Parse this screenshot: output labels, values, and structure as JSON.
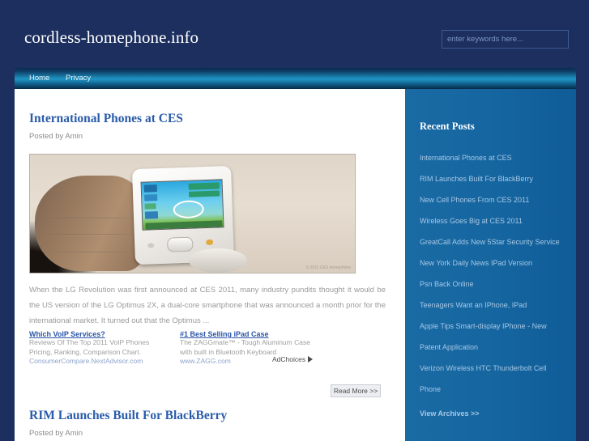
{
  "site": {
    "title": "cordless-homephone.info"
  },
  "search": {
    "placeholder": "enter keywords here...",
    "value": ""
  },
  "nav": {
    "items": [
      {
        "label": "Home"
      },
      {
        "label": "Privacy"
      }
    ]
  },
  "posts": [
    {
      "title": "International Phones at CES",
      "meta": "Posted by Amin",
      "image_watermark": "© 2011 CES homephone",
      "body": "When the LG Revolution was first announced at CES 2011, many industry pundits thought it would be the US version of the LG Optimus 2X, a dual-core smartphone that was announced a month prior for the international market. It turned out that the Optimus ...",
      "read_more": "Read More >>"
    },
    {
      "title": "RIM Launches Built For BlackBerry",
      "meta": "Posted by Amin"
    }
  ],
  "ads": {
    "items": [
      {
        "title": "Which VoIP Services?",
        "line1": "Reviews Of The Top 2011 VoIP Phones",
        "line2": "Pricing, Ranking, Comparison Chart.",
        "url": "ConsumerCompare.NextAdvisor.com"
      },
      {
        "title": "#1 Best Selling iPad Case",
        "line1": "The ZAGGmate™ - Tough Aluminum Case",
        "line2": "with built in Bluetooth Keyboard",
        "url": "www.ZAGG.com"
      }
    ],
    "adchoices_label": "AdChoices"
  },
  "sidebar": {
    "title": "Recent Posts",
    "items": [
      {
        "label": "International Phones at CES"
      },
      {
        "label": "RIM Launches Built For BlackBerry"
      },
      {
        "label": "New Cell Phones From CES 2011"
      },
      {
        "label": "Wireless Goes Big at CES 2011"
      },
      {
        "label": "GreatCall Adds New 5Star Security Service"
      },
      {
        "label": "New York Daily News IPad Version"
      },
      {
        "label": "Psn Back Online"
      },
      {
        "label": "Teenagers Want an IPhone, IPad"
      },
      {
        "label": "Apple Tips Smart-display IPhone - New"
      },
      {
        "label": "Patent Application"
      },
      {
        "label": "Verizon Wireless HTC Thunderbolt Cell"
      },
      {
        "label": "Phone"
      }
    ],
    "view_archives": "View Archives >>"
  },
  "colors": {
    "page_background": "#1c2f5e",
    "nav_accent": "#1e95c4",
    "sidebar": "#1565a0",
    "link": "#2a5caa",
    "sidebar_link": "#a7c8e4"
  }
}
